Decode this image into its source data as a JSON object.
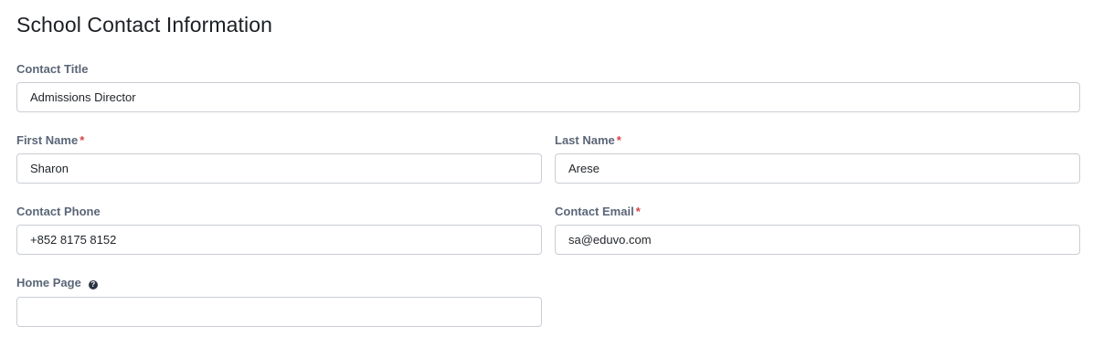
{
  "form": {
    "title": "School Contact Information",
    "required_marker": "*",
    "help_icon_glyph": "?",
    "fields": {
      "contact_title": {
        "label": "Contact Title",
        "value": "Admissions Director"
      },
      "first_name": {
        "label": "First Name",
        "value": "Sharon"
      },
      "last_name": {
        "label": "Last Name",
        "value": "Arese"
      },
      "contact_phone": {
        "label": "Contact Phone",
        "value": "+852 8175 8152"
      },
      "contact_email": {
        "label": "Contact Email",
        "value": "sa@eduvo.com"
      },
      "home_page": {
        "label": "Home Page",
        "value": ""
      }
    }
  },
  "colors": {
    "label": "#5b6678",
    "required": "#d64545",
    "input_border": "#c9cdd3",
    "help_icon": "#2a3342"
  },
  "icons": {
    "home_page_help": "question-circle-icon"
  }
}
